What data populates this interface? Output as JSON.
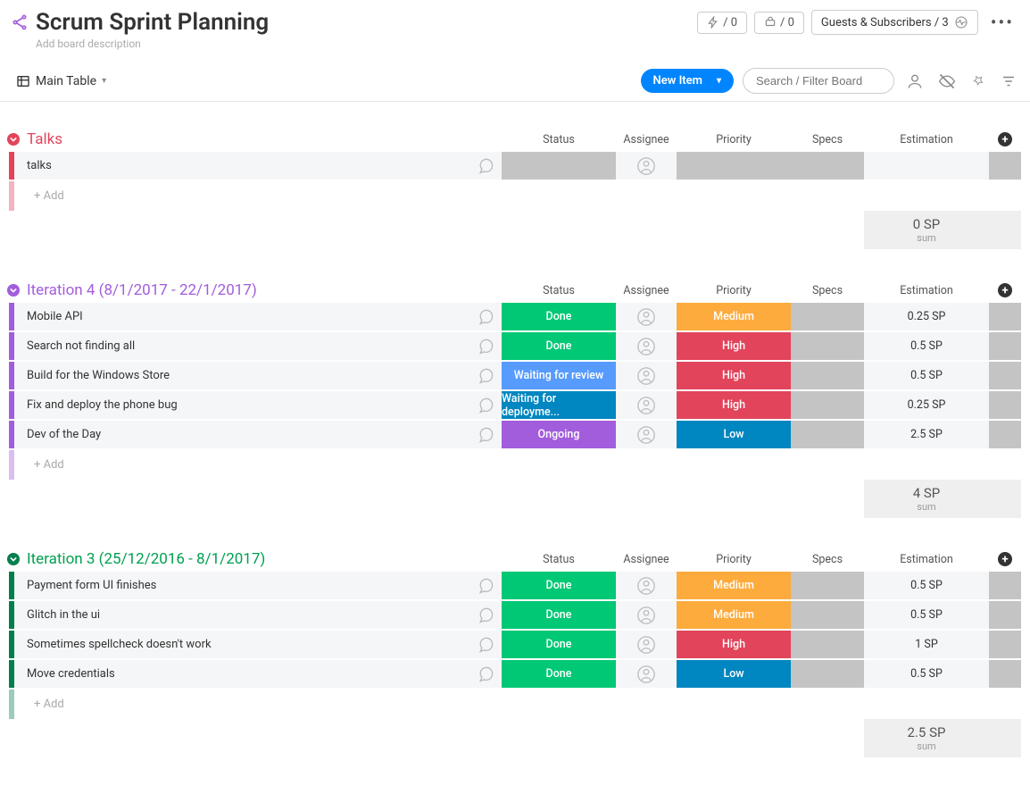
{
  "header": {
    "title": "Scrum Sprint Planning",
    "description": "Add board description",
    "hex1": "/ 0",
    "hex2": "/ 0",
    "guests": "Guests & Subscribers / 3"
  },
  "viewbar": {
    "main_table": "Main Table",
    "new_item": "New Item",
    "search_placeholder": "Search / Filter Board"
  },
  "columns": {
    "status": "Status",
    "assignee": "Assignee",
    "priority": "Priority",
    "specs": "Specs",
    "estimation": "Estimation"
  },
  "status_colors": {
    "Done": "#00c875",
    "Waiting for review": "#579bfc",
    "Waiting for deployme...": "#0086c0",
    "Ongoing": "#a25ddc"
  },
  "priority_colors": {
    "Medium": "#fdab3d",
    "High": "#e2445c",
    "Low": "#0086c0"
  },
  "add_label": "+ Add",
  "sum_label": "sum",
  "groups": [
    {
      "id": "talks",
      "title": "Talks",
      "accent": "#e2445c",
      "rows": [
        {
          "title": "talks",
          "status": "",
          "priority": "",
          "specs_gray": true,
          "estimation": "",
          "tail_gray": true
        }
      ],
      "summary": "0 SP"
    },
    {
      "id": "it4",
      "title": "Iteration 4 (8/1/2017 - 22/1/2017)",
      "accent": "#a25ddc",
      "rows": [
        {
          "title": "Mobile API",
          "status": "Done",
          "priority": "Medium",
          "specs_gray": true,
          "estimation": "0.25 SP",
          "tail_gray": true
        },
        {
          "title": "Search not finding all",
          "status": "Done",
          "priority": "High",
          "specs_gray": true,
          "estimation": "0.5 SP",
          "tail_gray": true
        },
        {
          "title": "Build for the Windows Store",
          "status": "Waiting for review",
          "priority": "High",
          "specs_gray": true,
          "estimation": "0.5 SP",
          "tail_gray": true
        },
        {
          "title": "Fix and deploy the phone bug",
          "status": "Waiting for deployme...",
          "priority": "High",
          "specs_gray": true,
          "estimation": "0.25 SP",
          "tail_gray": true
        },
        {
          "title": "Dev of the Day",
          "status": "Ongoing",
          "priority": "Low",
          "specs_gray": true,
          "estimation": "2.5 SP",
          "tail_gray": true
        }
      ],
      "summary": "4 SP"
    },
    {
      "id": "it3",
      "title": "Iteration 3 (25/12/2016 - 8/1/2017)",
      "accent": "#037f4c",
      "title_color": "#00a050",
      "rows": [
        {
          "title": "Payment form UI finishes",
          "status": "Done",
          "priority": "Medium",
          "specs_gray": true,
          "estimation": "0.5 SP",
          "tail_gray": true
        },
        {
          "title": "Glitch in the ui",
          "status": "Done",
          "priority": "Medium",
          "specs_gray": true,
          "estimation": "0.5 SP",
          "tail_gray": true
        },
        {
          "title": "Sometimes spellcheck doesn't work",
          "status": "Done",
          "priority": "High",
          "specs_gray": true,
          "estimation": "1 SP",
          "tail_gray": true
        },
        {
          "title": "Move credentials",
          "status": "Done",
          "priority": "Low",
          "specs_gray": true,
          "estimation": "0.5 SP",
          "tail_gray": true
        }
      ],
      "summary": "2.5 SP"
    }
  ]
}
